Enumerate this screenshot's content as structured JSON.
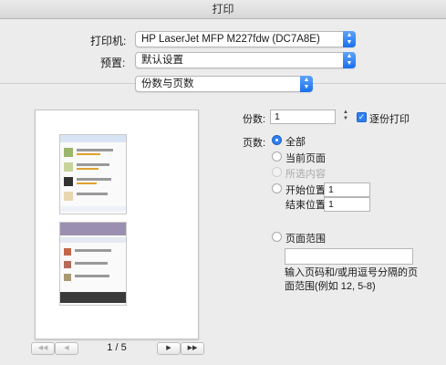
{
  "window": {
    "title": "打印"
  },
  "printer": {
    "label": "打印机:",
    "value": "HP LaserJet MFP M227fdw (DC7A8E)"
  },
  "presets": {
    "label": "预置:",
    "value": "默认设置"
  },
  "section": {
    "value": "份数与页数"
  },
  "preview": {
    "page_indicator": "1 / 5",
    "nav": {
      "first": "◀◀",
      "prev": "◀",
      "next": "▶",
      "last": "▶▶"
    }
  },
  "copies": {
    "label": "份数:",
    "value": "1",
    "collate": {
      "label": "逐份打印",
      "checked": true
    }
  },
  "pages": {
    "label": "页数:",
    "all": "全部",
    "current": "当前页面",
    "selection": "所选内容",
    "from_label": "开始位置:",
    "from_value": "1",
    "to_label": "结束位置:",
    "to_value": "1",
    "range_label": "页面范围",
    "range_value": "",
    "hint": "输入页码和/或用逗号分隔的页面范围(例如 12, 5-8)"
  },
  "colors": {
    "accent": "#2f7ff0"
  }
}
